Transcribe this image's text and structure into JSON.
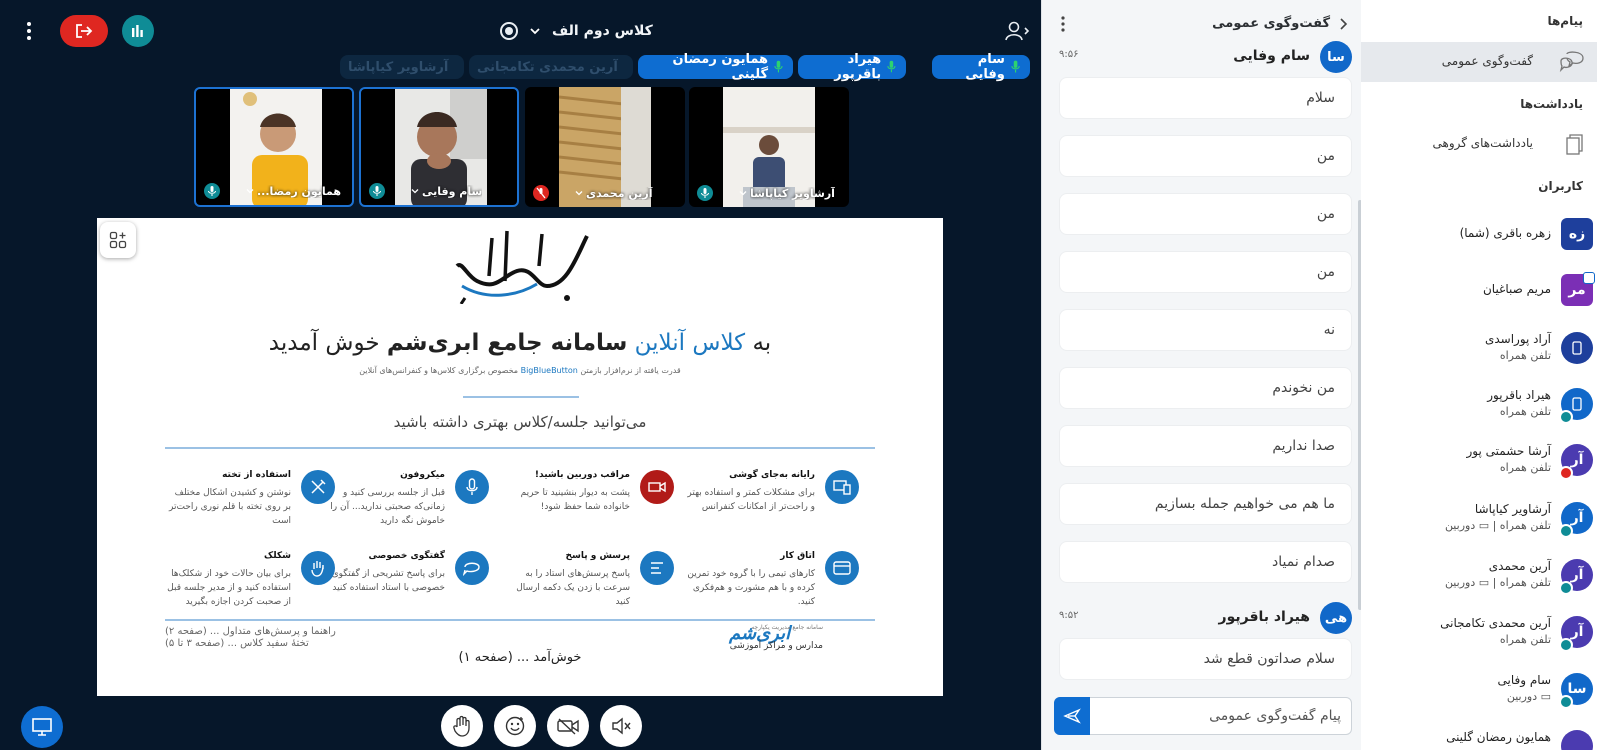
{
  "colors": {
    "background": "#06172a",
    "primary": "#0e6dd1",
    "leave": "#df2721",
    "stats": "#0f8c96",
    "chat_bg": "#f4f6f8"
  },
  "header": {
    "meeting_title": "کلاس دوم الف",
    "icons": [
      "kebab-icon",
      "leave-icon",
      "stats-icon",
      "record-icon",
      "chevron-down-icon",
      "add-user-icon"
    ]
  },
  "speakers": [
    {
      "name": "سام وفایی",
      "active": true
    },
    {
      "name": "هیراد باقرپور",
      "active": true
    },
    {
      "name": "همایون رمضان گلینی",
      "active": true
    },
    {
      "name": "آرین محمدی تکامجانی",
      "active": false
    },
    {
      "name": "آرشاویر کیاپاشا",
      "active": false
    }
  ],
  "videos": [
    {
      "name": "آرشاویر کیاپاشا",
      "mic": "on"
    },
    {
      "name": "آرین محمدی",
      "mic": "off"
    },
    {
      "name": "سام وفایی",
      "mic": "on"
    },
    {
      "name": "همایون رمضا...",
      "mic": "on"
    }
  ],
  "presentation": {
    "welcome_pre": "به",
    "welcome_blue": "کلاس آنلاین",
    "welcome_bold": "سامانه جامع ابری‌شم",
    "welcome_post": "خوش آمدید",
    "powered_pre": "قدرت یافته از نرم‌افزار بازمتن",
    "powered_blue": "BigBlueButton",
    "powered_post": "مخصوص برگزاری کلاس‌ها و کنفرانس‌های آنلاین",
    "subtitle": "می‌توانید جلسه/کلاس بهتری داشته باشید",
    "features": [
      {
        "title": "رایانه به‌جای گوشی",
        "desc": "برای مشکلات کمتر و استفاده بهتر و راحت‌تر از امکانات کنفرانس",
        "icon": "devices-icon"
      },
      {
        "title": "مراقب دوربین باشید!",
        "desc": "پشت به دیوار بنشینید تا حریم خانواده شما حفظ شود!",
        "icon": "camera-icon"
      },
      {
        "title": "میکروفون",
        "desc": "قبل از جلسه بررسی کنید و زمانی‌که صحبتی ندارید... آن را خاموش نگه دارید",
        "icon": "microphone-icon"
      },
      {
        "title": "استفاده از تخته",
        "desc": "نوشتن و کشیدن اشکال مختلف بر روی تخته با قلم نوری راحت‌تر است",
        "icon": "pen-icon"
      },
      {
        "title": "اتاق کار",
        "desc": "کارهای تیمی را با گروه خود تمرین کرده و با هم مشورت و هم‌فکری کنید.",
        "icon": "breakout-icon"
      },
      {
        "title": "پرسش و پاسخ",
        "desc": "پاسخ پرسش‌های استاد را به سرعت با زدن یک دکمه ارسال کنید",
        "icon": "poll-icon"
      },
      {
        "title": "گفتگوی خصوصی",
        "desc": "برای پاسخ تشریحی از گفتگوی خصوصی با استاد استفاده کنید",
        "icon": "chat-icon"
      },
      {
        "title": "شکلک",
        "desc": "برای بیان حالات خود از شکلک‌ها استفاده کنید و از مدیر جلسه قبل از صحبت کردن اجازه بگیرید",
        "icon": "hand-icon"
      }
    ],
    "footer_left_1": "راهنما و پرسش‌های متداول ... (صفحه ۲)",
    "footer_left_2": "تختهٔ سفید کلاس ... (صفحه ۳ تا ۵)",
    "footer_center": "خوش‌آمد ... (صفحه ۱)",
    "logo_name": "ابری‌شم",
    "logo_sub": "سامانه جامع مدیریت یکپارچه",
    "logo_tag": "مدارس و مراکز آموزشی"
  },
  "controls": [
    "hand-icon",
    "emoji-icon",
    "camera-off-icon",
    "speaker-off-icon",
    "presentation-icon"
  ],
  "chat": {
    "title": "گفت‌وگوی عمومی",
    "sender1": {
      "name": "سام وفایی",
      "initials": "سا",
      "time": "۹:۵۶"
    },
    "messages1": [
      "سلام",
      "من",
      "من",
      "من",
      "نه",
      "من نخوندم",
      "صدا نداریم",
      "ما هم می خواهیم جمله بسازیم",
      "صدام نمیاد"
    ],
    "sender2": {
      "name": "هیراد باقرپور",
      "initials": "هی",
      "time": "۹:۵۲"
    },
    "messages2": [
      "سلام صداتون قطع شد"
    ],
    "input_placeholder": "پیام گفت‌وگوی عمومی"
  },
  "userlist": {
    "messages_heading": "پیام‌ها",
    "public_chat": "گفت‌وگوی عمومی",
    "notes_heading": "یادداشت‌ها",
    "shared_notes": "یادداشت‌های گروهی",
    "users_heading": "کاربران",
    "users": [
      {
        "initials": "زه",
        "name": "زهره باقری (شما)",
        "status": "",
        "color": "#1e3f9c",
        "square": false
      },
      {
        "initials": "مر",
        "name": "مریم صباغیان",
        "status": "",
        "color": "#7b2fb5",
        "square": true
      },
      {
        "initials": "",
        "name": "آراد پوراسدی",
        "status": "تلفن همراه",
        "color": "#1e3f9c",
        "square": false
      },
      {
        "initials": "",
        "name": "هیراد باقرپور",
        "status": "تلفن همراه",
        "color": "#1168c9",
        "square": false
      },
      {
        "initials": "آر",
        "name": "آرشا حشمتی پور",
        "status": "تلفن همراه",
        "color": "#4b3bb0",
        "square": false
      },
      {
        "initials": "آر",
        "name": "آرشاویر کیاپاشا",
        "status": "تلفن همراه | ▭ دوربین",
        "color": "#1168c9",
        "square": false
      },
      {
        "initials": "آر",
        "name": "آرین محمدی",
        "status": "تلفن همراه | ▭ دوربین",
        "color": "#4b3bb0",
        "square": false
      },
      {
        "initials": "آر",
        "name": "آرین محمدی تکامجانی",
        "status": "تلفن همراه",
        "color": "#4b3bb0",
        "square": false
      },
      {
        "initials": "سا",
        "name": "سام وفایی",
        "status": "▭ دوربین",
        "color": "#1168c9",
        "square": false
      },
      {
        "initials": "",
        "name": "همایون رمضان گلینی",
        "status": "",
        "color": "#4b3bb0",
        "square": false
      }
    ]
  }
}
